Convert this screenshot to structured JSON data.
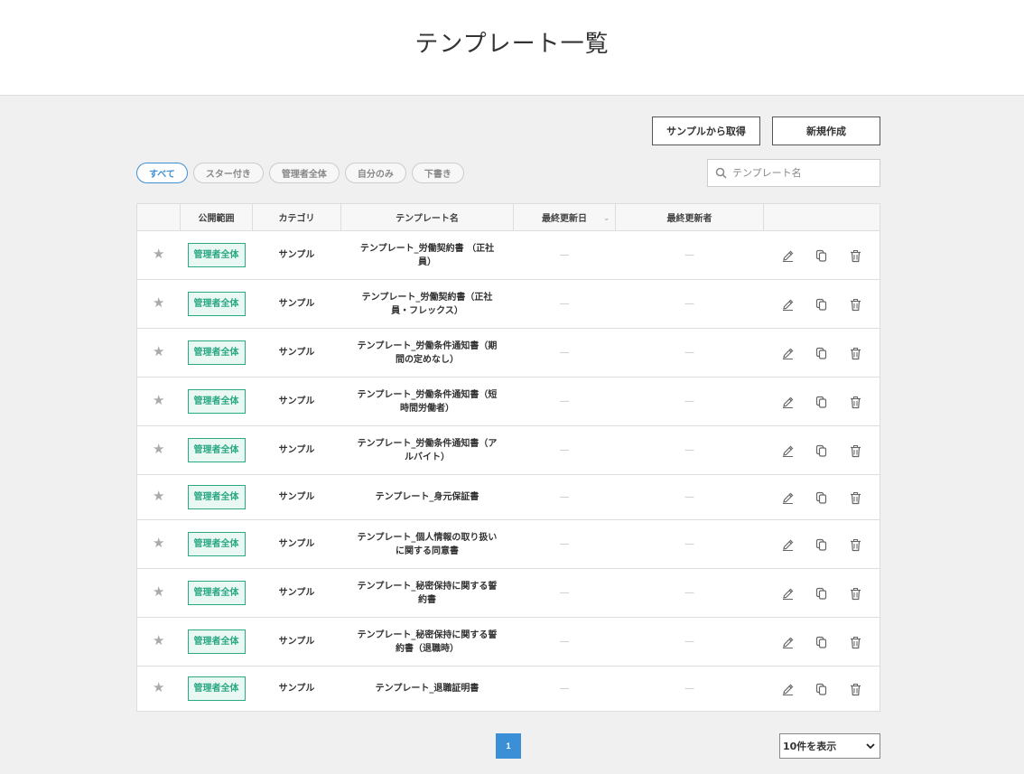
{
  "header": {
    "title": "テンプレート一覧"
  },
  "toolbar": {
    "sample_label": "サンプルから取得",
    "new_label": "新規作成"
  },
  "filters": [
    {
      "label": "すべて",
      "active": true
    },
    {
      "label": "スター付き",
      "active": false
    },
    {
      "label": "管理者全体",
      "active": false
    },
    {
      "label": "自分のみ",
      "active": false
    },
    {
      "label": "下書き",
      "active": false
    }
  ],
  "search": {
    "placeholder": "テンプレート名"
  },
  "table": {
    "columns": [
      "公開範囲",
      "カテゴリ",
      "テンプレート名",
      "最終更新日",
      "最終更新者"
    ],
    "rows": [
      {
        "scope": "管理者全体",
        "category": "サンプル",
        "name_lines": [
          "テンプレート_労働契約書 （正社",
          "員）"
        ],
        "updated": "―",
        "updater": "―"
      },
      {
        "scope": "管理者全体",
        "category": "サンプル",
        "name_lines": [
          "テンプレート_労働契約書（正社",
          "員・フレックス）"
        ],
        "updated": "―",
        "updater": "―"
      },
      {
        "scope": "管理者全体",
        "category": "サンプル",
        "name_lines": [
          "テンプレート_労働条件通知書（期",
          "間の定めなし）"
        ],
        "updated": "―",
        "updater": "―"
      },
      {
        "scope": "管理者全体",
        "category": "サンプル",
        "name_lines": [
          "テンプレート_労働条件通知書（短",
          "時間労働者）"
        ],
        "updated": "―",
        "updater": "―"
      },
      {
        "scope": "管理者全体",
        "category": "サンプル",
        "name_lines": [
          "テンプレート_労働条件通知書（ア",
          "ルバイト）"
        ],
        "updated": "―",
        "updater": "―"
      },
      {
        "scope": "管理者全体",
        "category": "サンプル",
        "name_lines": [
          "テンプレート_身元保証書"
        ],
        "updated": "―",
        "updater": "―"
      },
      {
        "scope": "管理者全体",
        "category": "サンプル",
        "name_lines": [
          "テンプレート_個人情報の取り扱い",
          "に関する同意書"
        ],
        "updated": "―",
        "updater": "―"
      },
      {
        "scope": "管理者全体",
        "category": "サンプル",
        "name_lines": [
          "テンプレート_秘密保持に関する誓",
          "約書"
        ],
        "updated": "―",
        "updater": "―"
      },
      {
        "scope": "管理者全体",
        "category": "サンプル",
        "name_lines": [
          "テンプレート_秘密保持に関する誓",
          "約書（退職時）"
        ],
        "updated": "―",
        "updater": "―"
      },
      {
        "scope": "管理者全体",
        "category": "サンプル",
        "name_lines": [
          "テンプレート_退職証明書"
        ],
        "updated": "―",
        "updater": "―"
      }
    ]
  },
  "pagination": {
    "current_page": "1",
    "per_page": "10件を表示"
  },
  "colors": {
    "accent": "#3b8fd6",
    "badge": "#2aa883"
  }
}
